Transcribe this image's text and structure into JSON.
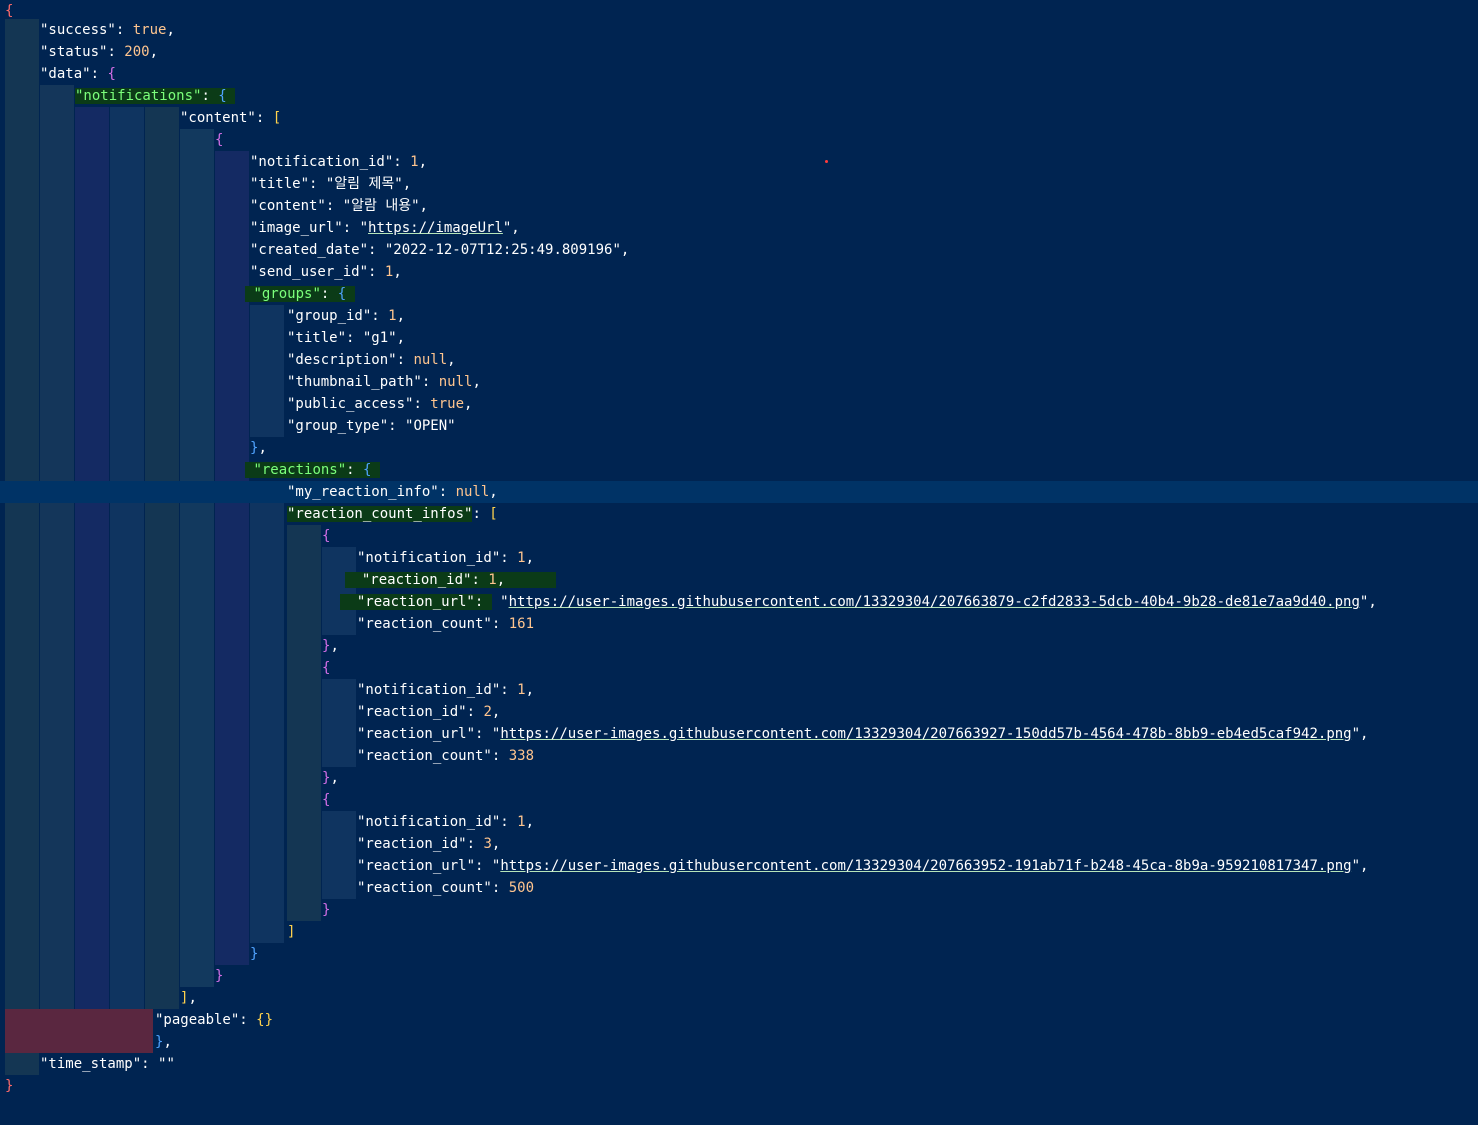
{
  "colors": {
    "background": "#002451",
    "guide_dark": "#1a3b5a",
    "guide_blue": "#0b2e5c",
    "guide_navy": "#142a63",
    "error_band": "#5a2740",
    "current_line": "#003366"
  },
  "json": {
    "success": "true",
    "status": "200",
    "notification_id": "1",
    "title": "\"알림 제목\"",
    "content": "\"알람 내용\"",
    "image_url": "https://imageUrl",
    "created_date": "\"2022-12-07T12:25:49.809196\"",
    "send_user_id": "1",
    "group_id": "1",
    "group_title": "\"g1\"",
    "description": "null",
    "thumbnail_path": "null",
    "public_access": "true",
    "group_type": "\"OPEN\"",
    "my_reaction_info": "null",
    "reactions": [
      {
        "notification_id": "1",
        "reaction_id": "1",
        "reaction_url": "https://user-images.githubusercontent.com/13329304/207663879-c2fd2833-5dcb-40b4-9b28-de81e7aa9d40.png",
        "reaction_count": "161"
      },
      {
        "notification_id": "1",
        "reaction_id": "2",
        "reaction_url": "https://user-images.githubusercontent.com/13329304/207663927-150dd57b-4564-478b-8bb9-eb4ed5caf942.png",
        "reaction_count": "338"
      },
      {
        "notification_id": "1",
        "reaction_id": "3",
        "reaction_url": "https://user-images.githubusercontent.com/13329304/207663952-191ab71f-b248-45ca-8b9a-959210817347.png",
        "reaction_count": "500"
      }
    ],
    "pageable": "{}",
    "time_stamp": "\"\""
  },
  "keys": {
    "success": "\"success\"",
    "status": "\"status\"",
    "data": "\"data\"",
    "notifications": "\"notifications\"",
    "content_arr": "\"content\"",
    "notification_id": "\"notification_id\"",
    "title": "\"title\"",
    "content": "\"content\"",
    "image_url": "\"image_url\"",
    "created_date": "\"created_date\"",
    "send_user_id": "\"send_user_id\"",
    "groups": "\"groups\"",
    "group_id": "\"group_id\"",
    "description": "\"description\"",
    "thumbnail_path": "\"thumbnail_path\"",
    "public_access": "\"public_access\"",
    "group_type": "\"group_type\"",
    "reactions": "\"reactions\"",
    "my_reaction_info": "\"my_reaction_info\"",
    "reaction_count_infos": "\"reaction_count_infos\"",
    "reaction_id": "\"reaction_id\"",
    "reaction_url": "\"reaction_url\"",
    "reaction_count": "\"reaction_count\"",
    "pageable": "\"pageable\"",
    "time_stamp": "\"time_stamp\""
  }
}
